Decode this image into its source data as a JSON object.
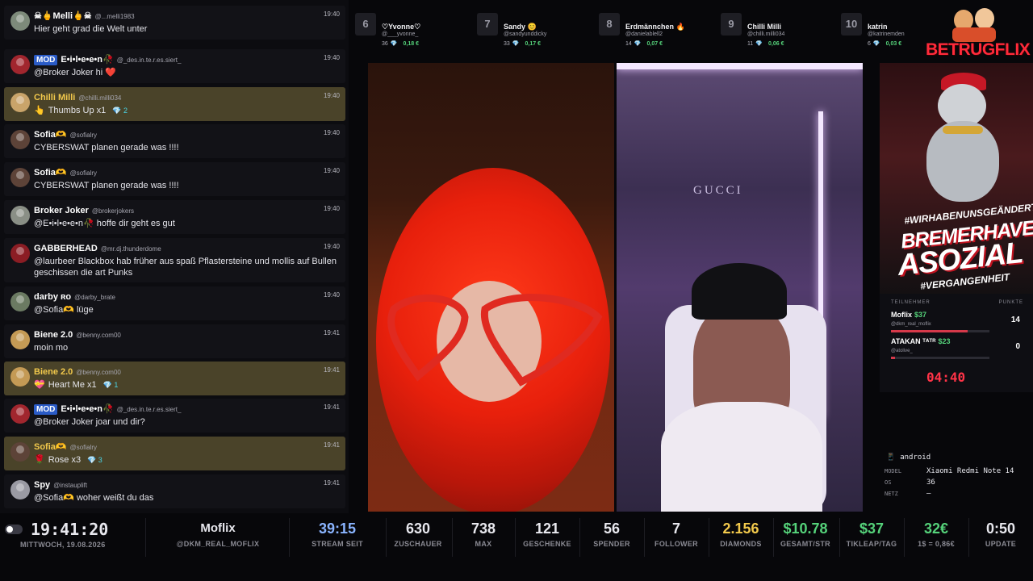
{
  "chat": {
    "messages": [
      {
        "name": "☠🖕Melli🖕☠",
        "handle": "@...melli1983",
        "time": "19:40",
        "text": "Hier geht grad die Welt unter"
      },
      {
        "badge": "MOD",
        "name": "E•i•l•e•e•n🥀",
        "handle": "@_des.in.te.r.es.siert_",
        "time": "19:40",
        "text": "@Broker Joker hi ❤️"
      },
      {
        "name": "Chilli Milli",
        "handle": "@chilli.milli034",
        "time": "19:40",
        "gift_icon": "👆",
        "text": "Thumbs Up x1",
        "diamonds": "💎 2"
      },
      {
        "name": "Sofia🫶",
        "handle": "@sofialry",
        "time": "19:40",
        "text": "CYBERSWAT planen gerade was !!!!"
      },
      {
        "name": "Sofia🫶",
        "handle": "@sofialry",
        "time": "19:40",
        "text": "CYBERSWAT planen gerade was !!!!"
      },
      {
        "name": "Broker Joker",
        "handle": "@brokerjokers",
        "time": "19:40",
        "text": "@E•i•l•e•e•n🥀 hoffe dir geht es gut"
      },
      {
        "name": "GABBERHEAD",
        "handle": "@mr.dj.thunderdome",
        "time": "19:40",
        "text": "@laurbeer Blackbox hab früher aus spaß Pflastersteine und mollis auf Bullen geschissen die art Punks"
      },
      {
        "name": "darby ʀᴏ",
        "handle": "@darby_brate",
        "time": "19:40",
        "text": "@Sofia🫶 lüge"
      },
      {
        "name": "Biene 2.0",
        "handle": "@benny.com00",
        "time": "19:41",
        "text": "moin mo"
      },
      {
        "name": "Biene 2.0",
        "handle": "@benny.com00",
        "time": "19:41",
        "gift_icon": "💝",
        "text": "Heart Me x1",
        "diamonds": "💎 1"
      },
      {
        "badge": "MOD",
        "name": "E•i•l•e•e•n🥀",
        "handle": "@_des.in.te.r.es.siert_",
        "time": "19:41",
        "text": "@Broker Joker joar und dir?"
      },
      {
        "name": "Sofia🫶",
        "handle": "@sofialry",
        "time": "19:41",
        "gift_icon": "🌹",
        "text": "Rose x3",
        "diamonds": "💎 3"
      },
      {
        "name": "Spy",
        "handle": "@instauplift",
        "time": "19:41",
        "text": "@Sofia🫶 woher weißt du das"
      }
    ]
  },
  "leaderboard": [
    {
      "rank": "6",
      "name": "♡Yvonne♡",
      "handle": "@___yvonne_",
      "count": "36",
      "diamond": "💎",
      "amount": "0,18 €"
    },
    {
      "rank": "7",
      "name": "Sandy 😊",
      "handle": "@sandyunddicky",
      "count": "33",
      "diamond": "💎",
      "amount": "0,17 €"
    },
    {
      "rank": "8",
      "name": "Erdmännchen 🔥",
      "handle": "@danielablell2",
      "count": "14",
      "diamond": "💎",
      "amount": "0,07 €"
    },
    {
      "rank": "9",
      "name": "Chilli Milli",
      "handle": "@chilli.milli034",
      "count": "11",
      "diamond": "💎",
      "amount": "0,06 €"
    },
    {
      "rank": "10",
      "name": "katrin",
      "handle": "@katrinemden",
      "count": "6",
      "diamond": "💎",
      "amount": "0,03 €"
    }
  ],
  "brand": {
    "logo_text": "BETRUGFLIX",
    "poster_tag_top": "#WIRHABENUNSGEÄNDERT",
    "poster_line1": "BREMERHAVEN",
    "poster_line2": "ASOZIAL",
    "poster_tag_bottom": "#VERGANGENHEIT"
  },
  "battle": {
    "header_left": "TEILNEHMER",
    "header_right": "PUNKTE",
    "participants": [
      {
        "name": "Moflix",
        "money": "$37",
        "handle": "@dkm_real_moflix",
        "points": "14",
        "progress": 0.78
      },
      {
        "name": "ATAKAN ᵀᴬᵀᴿ",
        "money": "$23",
        "handle": "@atolive_",
        "points": "0",
        "progress": 0.04
      }
    ],
    "timer": "04:40"
  },
  "device": {
    "os_icon": "📱",
    "os": "android",
    "rows": [
      {
        "key": "MODEL",
        "value": "Xiaomi Redmi Note 14"
      },
      {
        "key": "OS",
        "value": "36"
      },
      {
        "key": "NETZ",
        "value": "—"
      }
    ]
  },
  "footer": {
    "clock": "19:41:20",
    "date": "MITTWOCH, 19.08.2026",
    "streamer_name": "Moflix",
    "streamer_handle": "@DKM_REAL_MOFLIX",
    "stats": [
      {
        "value": "39:15",
        "label": "STREAM SEIT",
        "color": "#8ab4ff"
      },
      {
        "value": "630",
        "label": "ZUSCHAUER",
        "color": "#e8e8ee"
      },
      {
        "value": "738",
        "label": "MAX",
        "color": "#e8e8ee"
      },
      {
        "value": "121",
        "label": "GESCHENKE",
        "color": "#e8e8ee"
      },
      {
        "value": "56",
        "label": "SPENDER",
        "color": "#e8e8ee"
      },
      {
        "value": "7",
        "label": "FOLLOWER",
        "color": "#e8e8ee"
      },
      {
        "value": "2.156",
        "label": "DIAMONDS",
        "color": "#f2c94c"
      },
      {
        "value": "$10.78",
        "label": "GESAMT/STR",
        "color": "#55d27a"
      },
      {
        "value": "$37",
        "label": "TIKLEAP/TAG",
        "color": "#55d27a"
      },
      {
        "value": "32€",
        "label": "1$ = 0,86€",
        "color": "#55d27a"
      },
      {
        "value": "0:50",
        "label": "UPDATE",
        "color": "#e8e8ee"
      }
    ]
  },
  "colors": {
    "gift_row": "#4a4329",
    "gold": "#f2c94c",
    "money": "#55d27a",
    "diamond": "#4ad5e6",
    "accent_red": "#ff2a3a",
    "mod_badge": "#2a5bc7"
  }
}
